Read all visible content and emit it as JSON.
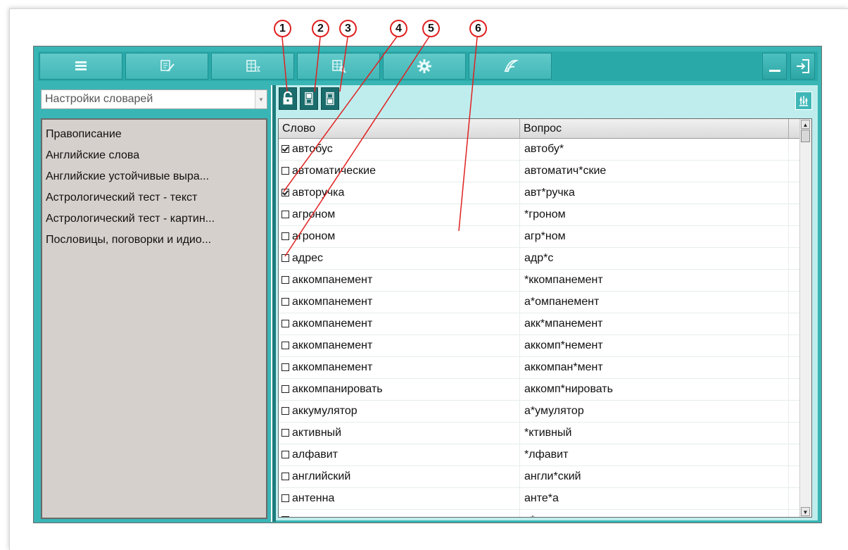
{
  "dictionary_selector": {
    "value": "Настройки словарей"
  },
  "dictionaries": [
    "Правописание",
    "Английские слова",
    "Английские устойчивые выра...",
    "Астрологический тест - текст",
    "Астрологический тест - картин...",
    "Пословицы, поговорки и идио..."
  ],
  "table": {
    "headers": {
      "word": "Слово",
      "question": "Вопрос"
    },
    "rows": [
      {
        "word": "автобус",
        "question": "автобу*",
        "checked": true
      },
      {
        "word": "автоматические",
        "question": "автоматич*ские",
        "checked": false
      },
      {
        "word": "авторучка",
        "question": "авт*ручка",
        "checked": true
      },
      {
        "word": "агроном",
        "question": "*гроном",
        "checked": false
      },
      {
        "word": "агроном",
        "question": "агр*ном",
        "checked": false
      },
      {
        "word": "адрес",
        "question": "адр*с",
        "checked": false
      },
      {
        "word": "аккомпанемент",
        "question": "*ккомпанемент",
        "checked": false
      },
      {
        "word": "аккомпанемент",
        "question": "а*омпанемент",
        "checked": false
      },
      {
        "word": "аккомпанемент",
        "question": "акк*мпанемент",
        "checked": false
      },
      {
        "word": "аккомпанемент",
        "question": "аккомп*немент",
        "checked": false
      },
      {
        "word": "аккомпанемент",
        "question": "аккомпан*мент",
        "checked": false
      },
      {
        "word": "аккомпанировать",
        "question": "аккомп*нировать",
        "checked": false
      },
      {
        "word": "аккумулятор",
        "question": "а*умулятор",
        "checked": false
      },
      {
        "word": "активный",
        "question": "*ктивный",
        "checked": false
      },
      {
        "word": "алфавит",
        "question": "*лфавит",
        "checked": false
      },
      {
        "word": "английский",
        "question": "англи*ский",
        "checked": false
      },
      {
        "word": "антенна",
        "question": "анте*а",
        "checked": false
      },
      {
        "word": "аппетит",
        "question": "а*етит",
        "checked": false
      }
    ]
  },
  "callouts": [
    "1",
    "2",
    "3",
    "4",
    "5",
    "6"
  ],
  "icons": {
    "toolbar": [
      "list-icon",
      "edit-check-icon",
      "sum-table-icon",
      "grid-search-icon",
      "gear-icon",
      "logo-icon"
    ],
    "window": [
      "minimize-icon",
      "exit-icon"
    ],
    "panel": [
      "lock-icon",
      "view-left-icon",
      "view-right-icon",
      "settings-sliders-icon"
    ]
  },
  "colors": {
    "accent": "#3ab5b5",
    "toolbar": "#2aa9a9",
    "dark_button": "#1b6c6c",
    "annotation": "#e02020"
  }
}
